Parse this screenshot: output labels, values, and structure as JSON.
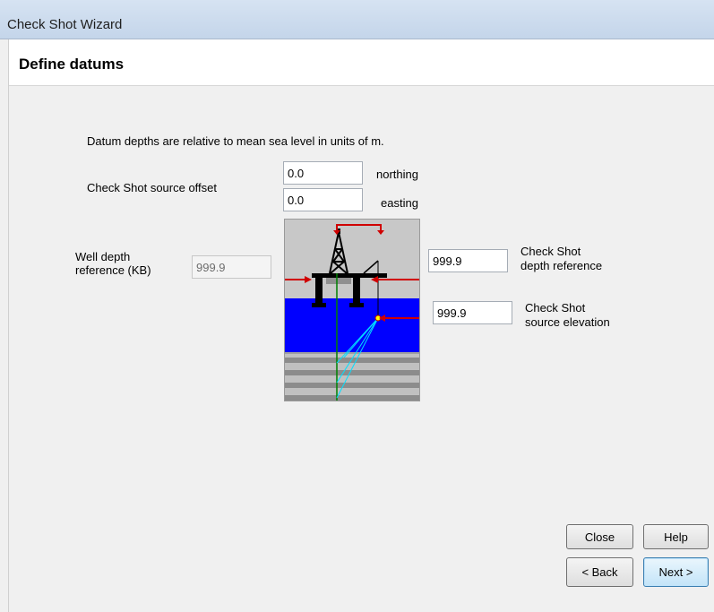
{
  "window": {
    "title": "Check Shot Wizard"
  },
  "header": {
    "title": "Define datums"
  },
  "intro_text": "Datum depths are relative to mean sea level in units of m.",
  "source_offset": {
    "label": "Check Shot source offset",
    "northing_value": "0.0",
    "northing_label": "northing",
    "easting_value": "0.0",
    "easting_label": "easting"
  },
  "well_depth": {
    "label_line1": "Well depth",
    "label_line2": "reference (KB)",
    "value": "999.9"
  },
  "depth_reference": {
    "value": "999.9",
    "label_line1": "Check Shot",
    "label_line2": "depth reference"
  },
  "source_elevation": {
    "value": "999.9",
    "label_line1": "Check Shot",
    "label_line2": "source elevation"
  },
  "buttons": {
    "close": "Close",
    "help": "Help",
    "back": "< Back",
    "next": "Next >"
  },
  "colors": {
    "water": "#0000ff",
    "arrow": "#d00000",
    "well": "#008000",
    "rays": "#00e0ff"
  }
}
